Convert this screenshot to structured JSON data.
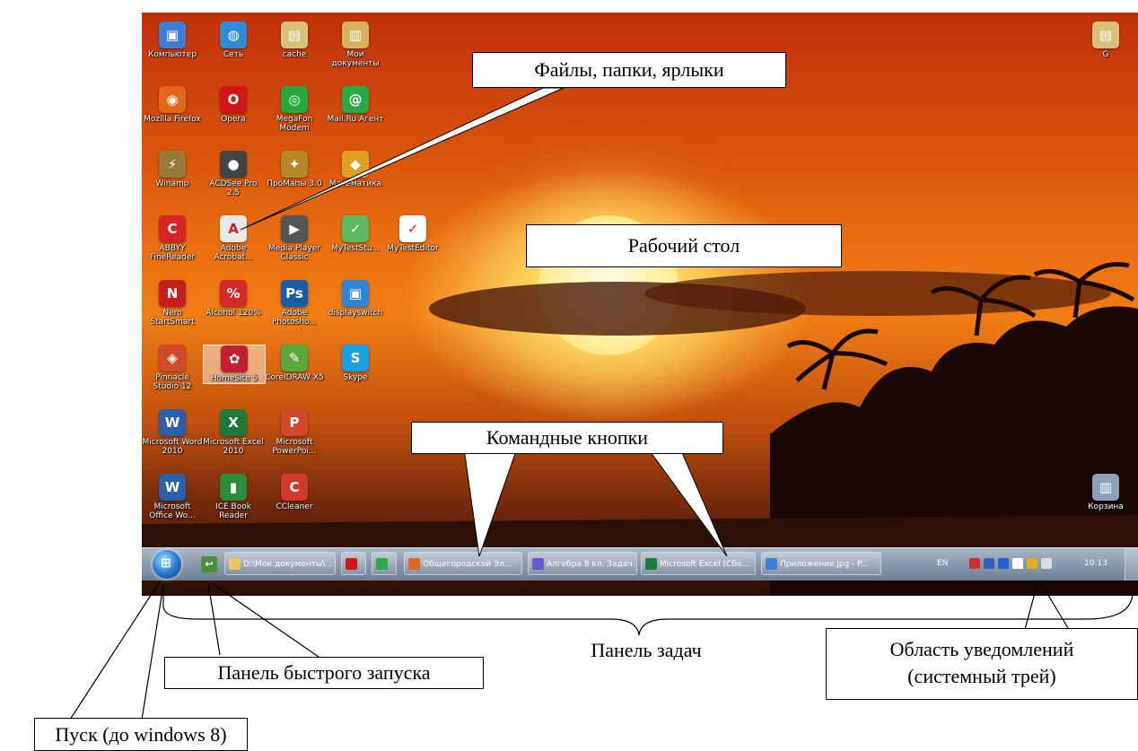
{
  "desktop": {
    "icons": [
      {
        "label": "Компьютер",
        "color": "#3d7fd6",
        "glyph": "▣"
      },
      {
        "label": "Сеть",
        "color": "#2e8bd8",
        "glyph": "◍"
      },
      {
        "label": "cache",
        "color": "#d8c27a",
        "glyph": "▤"
      },
      {
        "label": "Мои документы",
        "color": "#d4b25a",
        "glyph": "▥"
      },
      {
        "label": "Mozilla Firefox",
        "color": "#e0671c",
        "glyph": "◉"
      },
      {
        "label": "Opera",
        "color": "#d01818",
        "glyph": "O"
      },
      {
        "label": "MegaFon Modem",
        "color": "#27a83a",
        "glyph": "◎"
      },
      {
        "label": "Mail.Ru Агент",
        "color": "#2aa84a",
        "glyph": "@"
      },
      {
        "label": "Winamp",
        "color": "#9a7a3a",
        "glyph": "⚡"
      },
      {
        "label": "ACDSee Pro 2.5",
        "color": "#444444",
        "glyph": "●"
      },
      {
        "label": "ПроМапы 3.0",
        "color": "#b8862a",
        "glyph": "✦"
      },
      {
        "label": "Математика",
        "color": "#e0a020",
        "glyph": "◆"
      },
      {
        "label": "ABBYY FineReader",
        "color": "#d42424",
        "glyph": "C"
      },
      {
        "label": "Adobe Acrobat...",
        "color": "#e8e8e8",
        "glyph": "A"
      },
      {
        "label": "Media Player Classic",
        "color": "#555555",
        "glyph": "▶"
      },
      {
        "label": "MyTestStu...",
        "color": "#5cb85c",
        "glyph": "✓"
      },
      {
        "label": "MyTestEditor",
        "color": "#ffffff",
        "glyph": "✓"
      },
      {
        "label": "Nero StartSmart",
        "color": "#c41e1e",
        "glyph": "N"
      },
      {
        "label": "Alcohol 120%",
        "color": "#d42a2a",
        "glyph": "%"
      },
      {
        "label": "Adobe Photosho...",
        "color": "#1a5ca8",
        "glyph": "Ps"
      },
      {
        "label": "displayswitch",
        "color": "#2f86d6",
        "glyph": "▣"
      },
      {
        "label": "Pinnacle Studio 12",
        "color": "#d34b2c",
        "glyph": "◈"
      },
      {
        "label": "HomeSite 5",
        "color": "#c21f2f",
        "glyph": "✿"
      },
      {
        "label": "CorelDRAW X5",
        "color": "#5aa83a",
        "glyph": "✎"
      },
      {
        "label": "Skype",
        "color": "#1aa0e0",
        "glyph": "S"
      },
      {
        "label": "Microsoft Word 2010",
        "color": "#2b5faa",
        "glyph": "W"
      },
      {
        "label": "Microsoft Excel 2010",
        "color": "#1f7a3a",
        "glyph": "X"
      },
      {
        "label": "Microsoft PowerPoi...",
        "color": "#d2482a",
        "glyph": "P"
      },
      {
        "label": "Microsoft Office Wo...",
        "color": "#2b5faa",
        "glyph": "W"
      },
      {
        "label": "ICE Book Reader",
        "color": "#2e8b3a",
        "glyph": "▮"
      },
      {
        "label": "CCleaner",
        "color": "#d03a2a",
        "glyph": "C"
      },
      {
        "label": "G",
        "color": "#d8c27a",
        "glyph": "▤"
      },
      {
        "label": "Корзина",
        "color": "#8aa0b8",
        "glyph": "▥"
      }
    ]
  },
  "taskbar": {
    "start_glyph": "⊞",
    "quick_launch": [
      {
        "glyph": "↩",
        "color": "#4a8f3a"
      }
    ],
    "buttons": [
      {
        "label": "D:\\Мои документы\\...",
        "color": "#e8c860"
      },
      {
        "label": "",
        "color": "#d01818"
      },
      {
        "label": "",
        "color": "#2aa84a"
      },
      {
        "label": "Общегородской Эл...",
        "color": "#e0671c"
      },
      {
        "label": "Алгебра 8 кл. Задач...",
        "color": "#6a5acd"
      },
      {
        "label": "Microsoft Excel (Сбо...",
        "color": "#1f7a3a"
      },
      {
        "label": "Приложение.jpg - P...",
        "color": "#3d7fd6"
      }
    ],
    "tray": {
      "language": "EN",
      "icons": [
        "#d03030",
        "#3060c0",
        "#2060d0",
        "#ffffff",
        "#e0b020",
        "#dddddd"
      ],
      "clock": "10:13"
    }
  },
  "annotations": {
    "files": "Файлы, папки, ярлыки",
    "desktop": "Рабочий стол",
    "command_buttons": "Командные кнопки",
    "taskbar": "Панель задач",
    "quick_launch": "Панель быстрого запуска",
    "tray_line1": "Область уведомлений",
    "tray_line2": "(системный трей)",
    "start": "Пуск (до windows 8)"
  }
}
